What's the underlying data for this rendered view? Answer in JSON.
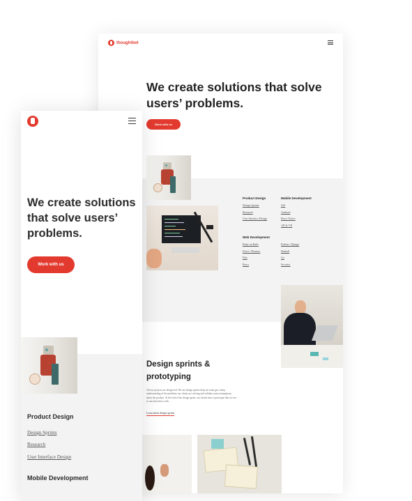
{
  "desktop": {
    "brand": "thoughtbot",
    "headline": "We create solutions that solve users’ problems.",
    "cta_label": "Work with us",
    "services": [
      {
        "heading": "Product Design",
        "items": [
          "Design Sprints",
          "Research",
          "User Interface Design"
        ]
      },
      {
        "heading": "Mobile Development",
        "items": [
          "iOS",
          "Android",
          "React Native",
          "AR & VR"
        ]
      },
      {
        "heading": "Web Development",
        "items": [
          "Ruby on Rails",
          "Elixir / Phoenix",
          "Elm",
          "React"
        ]
      },
      {
        "heading": "",
        "items": [
          "Python / Django",
          "Haskell",
          "Go",
          "Security"
        ]
      }
    ],
    "section_title": "Design sprints & prototyping",
    "section_body": "All our projects are design-led. We use design sprints help our team get a deep understanding of the problems our clients are solving and validate some assumptions about the product. At the end of the design sprint, our clients have a prototype that we use to run interviews with.",
    "learn_link": "Learn about design sprints"
  },
  "mobile": {
    "headline": "We create solutions that solve users’ problems.",
    "cta_label": "Work with us",
    "services": [
      {
        "heading": "Product Design",
        "items": [
          "Design Sprints",
          "Research",
          "User Interface Design"
        ]
      },
      {
        "heading": "Mobile Development"
      }
    ]
  },
  "colors": {
    "accent": "#e33a2f",
    "band": "#f3f3f3"
  },
  "icons": {
    "logo": "thoughtbot-robot-logo",
    "menu": "hamburger-menu-icon"
  }
}
